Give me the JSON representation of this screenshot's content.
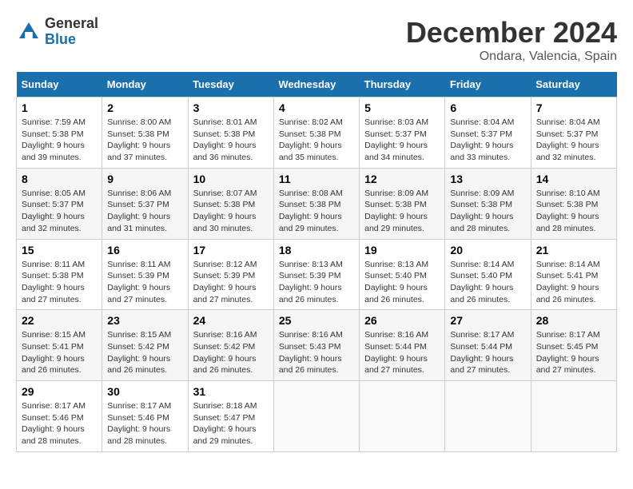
{
  "header": {
    "logo": {
      "general": "General",
      "blue": "Blue"
    },
    "title": "December 2024",
    "location": "Ondara, Valencia, Spain"
  },
  "calendar": {
    "days_of_week": [
      "Sunday",
      "Monday",
      "Tuesday",
      "Wednesday",
      "Thursday",
      "Friday",
      "Saturday"
    ],
    "weeks": [
      [
        {
          "day": "",
          "empty": true
        },
        {
          "day": "",
          "empty": true
        },
        {
          "day": "",
          "empty": true
        },
        {
          "day": "",
          "empty": true
        },
        {
          "day": "5",
          "sunrise": "Sunrise: 8:03 AM",
          "sunset": "Sunset: 5:37 PM",
          "daylight": "Daylight: 9 hours and 34 minutes."
        },
        {
          "day": "6",
          "sunrise": "Sunrise: 8:04 AM",
          "sunset": "Sunset: 5:37 PM",
          "daylight": "Daylight: 9 hours and 33 minutes."
        },
        {
          "day": "7",
          "sunrise": "Sunrise: 8:04 AM",
          "sunset": "Sunset: 5:37 PM",
          "daylight": "Daylight: 9 hours and 32 minutes."
        }
      ],
      [
        {
          "day": "1",
          "sunrise": "Sunrise: 7:59 AM",
          "sunset": "Sunset: 5:38 PM",
          "daylight": "Daylight: 9 hours and 39 minutes."
        },
        {
          "day": "2",
          "sunrise": "Sunrise: 8:00 AM",
          "sunset": "Sunset: 5:38 PM",
          "daylight": "Daylight: 9 hours and 37 minutes."
        },
        {
          "day": "3",
          "sunrise": "Sunrise: 8:01 AM",
          "sunset": "Sunset: 5:38 PM",
          "daylight": "Daylight: 9 hours and 36 minutes."
        },
        {
          "day": "4",
          "sunrise": "Sunrise: 8:02 AM",
          "sunset": "Sunset: 5:38 PM",
          "daylight": "Daylight: 9 hours and 35 minutes."
        },
        {
          "day": "",
          "empty": true
        },
        {
          "day": "",
          "empty": true
        },
        {
          "day": "",
          "empty": true
        }
      ],
      [
        {
          "day": "8",
          "sunrise": "Sunrise: 8:05 AM",
          "sunset": "Sunset: 5:37 PM",
          "daylight": "Daylight: 9 hours and 32 minutes."
        },
        {
          "day": "9",
          "sunrise": "Sunrise: 8:06 AM",
          "sunset": "Sunset: 5:37 PM",
          "daylight": "Daylight: 9 hours and 31 minutes."
        },
        {
          "day": "10",
          "sunrise": "Sunrise: 8:07 AM",
          "sunset": "Sunset: 5:38 PM",
          "daylight": "Daylight: 9 hours and 30 minutes."
        },
        {
          "day": "11",
          "sunrise": "Sunrise: 8:08 AM",
          "sunset": "Sunset: 5:38 PM",
          "daylight": "Daylight: 9 hours and 29 minutes."
        },
        {
          "day": "12",
          "sunrise": "Sunrise: 8:09 AM",
          "sunset": "Sunset: 5:38 PM",
          "daylight": "Daylight: 9 hours and 29 minutes."
        },
        {
          "day": "13",
          "sunrise": "Sunrise: 8:09 AM",
          "sunset": "Sunset: 5:38 PM",
          "daylight": "Daylight: 9 hours and 28 minutes."
        },
        {
          "day": "14",
          "sunrise": "Sunrise: 8:10 AM",
          "sunset": "Sunset: 5:38 PM",
          "daylight": "Daylight: 9 hours and 28 minutes."
        }
      ],
      [
        {
          "day": "15",
          "sunrise": "Sunrise: 8:11 AM",
          "sunset": "Sunset: 5:38 PM",
          "daylight": "Daylight: 9 hours and 27 minutes."
        },
        {
          "day": "16",
          "sunrise": "Sunrise: 8:11 AM",
          "sunset": "Sunset: 5:39 PM",
          "daylight": "Daylight: 9 hours and 27 minutes."
        },
        {
          "day": "17",
          "sunrise": "Sunrise: 8:12 AM",
          "sunset": "Sunset: 5:39 PM",
          "daylight": "Daylight: 9 hours and 27 minutes."
        },
        {
          "day": "18",
          "sunrise": "Sunrise: 8:13 AM",
          "sunset": "Sunset: 5:39 PM",
          "daylight": "Daylight: 9 hours and 26 minutes."
        },
        {
          "day": "19",
          "sunrise": "Sunrise: 8:13 AM",
          "sunset": "Sunset: 5:40 PM",
          "daylight": "Daylight: 9 hours and 26 minutes."
        },
        {
          "day": "20",
          "sunrise": "Sunrise: 8:14 AM",
          "sunset": "Sunset: 5:40 PM",
          "daylight": "Daylight: 9 hours and 26 minutes."
        },
        {
          "day": "21",
          "sunrise": "Sunrise: 8:14 AM",
          "sunset": "Sunset: 5:41 PM",
          "daylight": "Daylight: 9 hours and 26 minutes."
        }
      ],
      [
        {
          "day": "22",
          "sunrise": "Sunrise: 8:15 AM",
          "sunset": "Sunset: 5:41 PM",
          "daylight": "Daylight: 9 hours and 26 minutes."
        },
        {
          "day": "23",
          "sunrise": "Sunrise: 8:15 AM",
          "sunset": "Sunset: 5:42 PM",
          "daylight": "Daylight: 9 hours and 26 minutes."
        },
        {
          "day": "24",
          "sunrise": "Sunrise: 8:16 AM",
          "sunset": "Sunset: 5:42 PM",
          "daylight": "Daylight: 9 hours and 26 minutes."
        },
        {
          "day": "25",
          "sunrise": "Sunrise: 8:16 AM",
          "sunset": "Sunset: 5:43 PM",
          "daylight": "Daylight: 9 hours and 26 minutes."
        },
        {
          "day": "26",
          "sunrise": "Sunrise: 8:16 AM",
          "sunset": "Sunset: 5:44 PM",
          "daylight": "Daylight: 9 hours and 27 minutes."
        },
        {
          "day": "27",
          "sunrise": "Sunrise: 8:17 AM",
          "sunset": "Sunset: 5:44 PM",
          "daylight": "Daylight: 9 hours and 27 minutes."
        },
        {
          "day": "28",
          "sunrise": "Sunrise: 8:17 AM",
          "sunset": "Sunset: 5:45 PM",
          "daylight": "Daylight: 9 hours and 27 minutes."
        }
      ],
      [
        {
          "day": "29",
          "sunrise": "Sunrise: 8:17 AM",
          "sunset": "Sunset: 5:46 PM",
          "daylight": "Daylight: 9 hours and 28 minutes."
        },
        {
          "day": "30",
          "sunrise": "Sunrise: 8:17 AM",
          "sunset": "Sunset: 5:46 PM",
          "daylight": "Daylight: 9 hours and 28 minutes."
        },
        {
          "day": "31",
          "sunrise": "Sunrise: 8:18 AM",
          "sunset": "Sunset: 5:47 PM",
          "daylight": "Daylight: 9 hours and 29 minutes."
        },
        {
          "day": "",
          "empty": true
        },
        {
          "day": "",
          "empty": true
        },
        {
          "day": "",
          "empty": true
        },
        {
          "day": "",
          "empty": true
        }
      ]
    ]
  }
}
